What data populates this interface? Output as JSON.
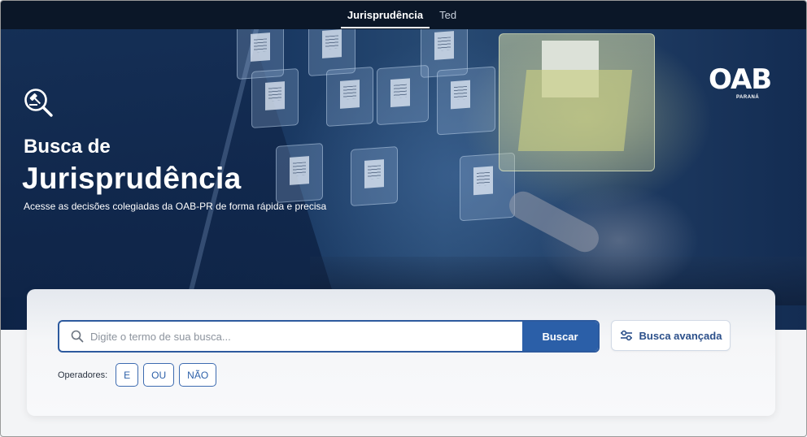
{
  "topbar": {
    "tabs": [
      {
        "label": "Jurisprudência",
        "active": true
      },
      {
        "label": "Ted",
        "active": false
      }
    ]
  },
  "hero": {
    "icon": "gavel-magnifier-icon",
    "title_small": "Busca de",
    "title_big": "Jurisprudência",
    "subtitle": "Acesse as decisões colegiadas da OAB-PR de forma rápida e precisa"
  },
  "logo": {
    "brand": "OAB",
    "sub": "PARANÁ"
  },
  "search": {
    "placeholder": "Digite o termo de sua busca...",
    "value": "",
    "button_label": "Buscar",
    "advanced_label": "Busca avançada",
    "advanced_icon": "sliders-icon"
  },
  "operators": {
    "label": "Operadores:",
    "items": [
      "E",
      "OU",
      "NÃO"
    ]
  },
  "colors": {
    "topbar": "#0b1728",
    "primary": "#2b5fa8",
    "hero_dark": "#0d2346"
  }
}
